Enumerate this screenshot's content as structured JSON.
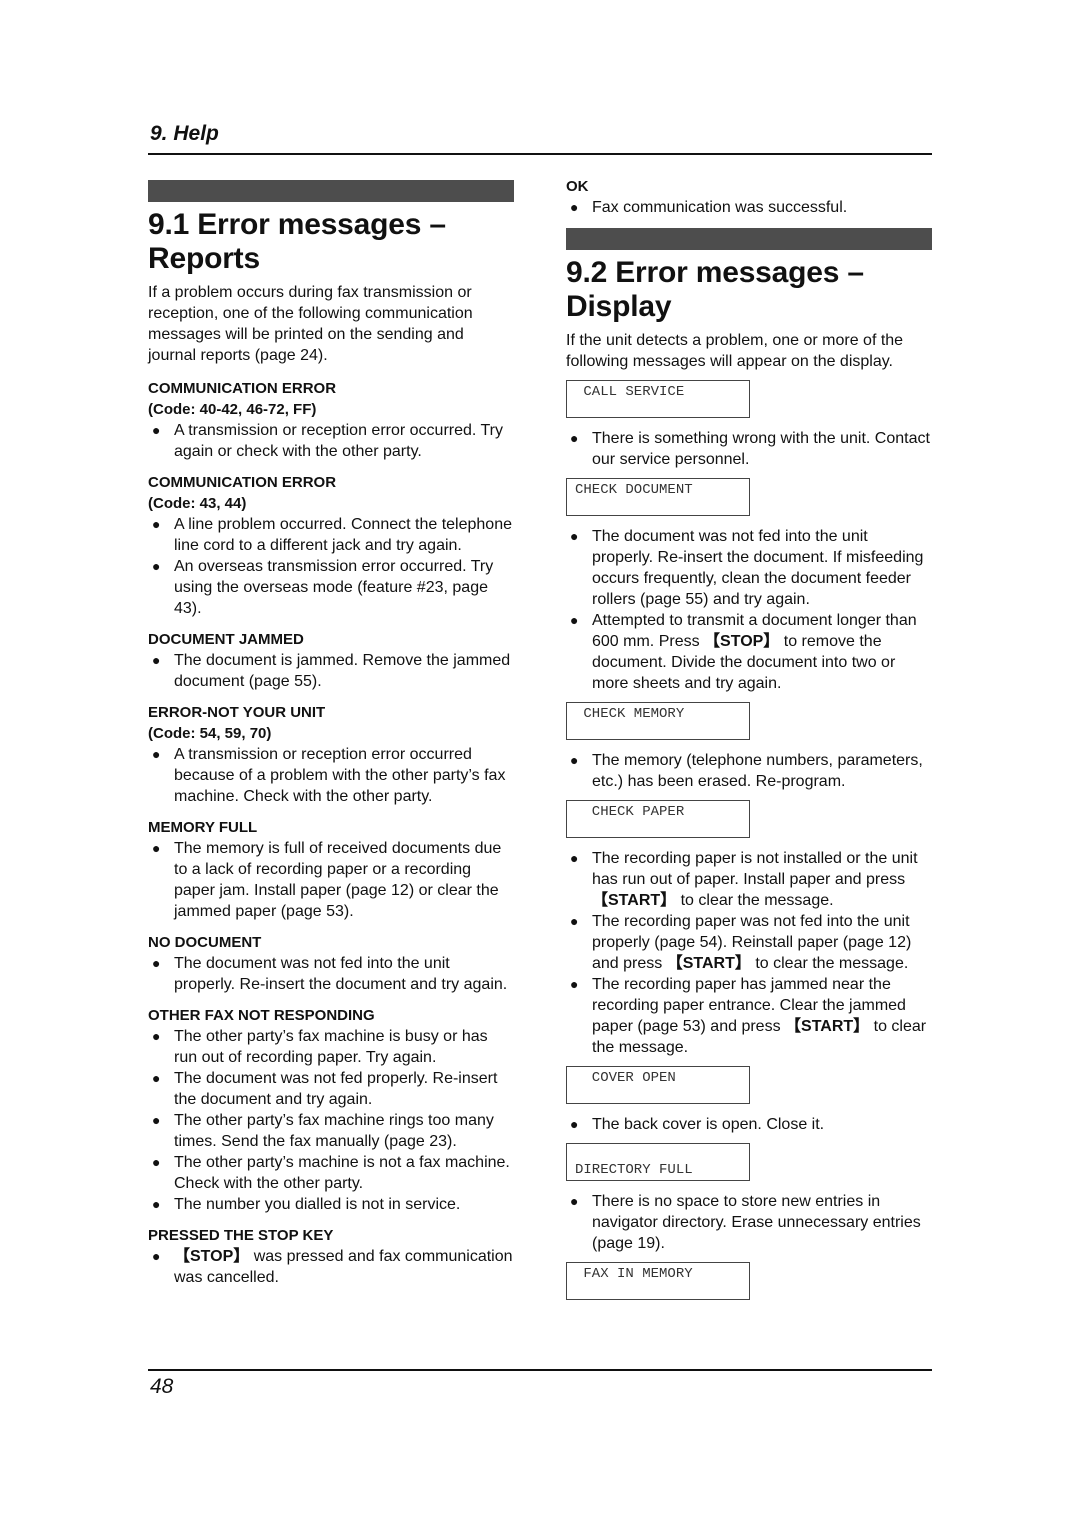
{
  "header": {
    "title": "9. Help"
  },
  "footer": {
    "page_number": "48"
  },
  "section1": {
    "title": "9.1 Error messages – Reports",
    "intro": "If a problem occurs during fax transmission or reception, one of the following communication messages will be printed on the sending and journal reports (page 24).",
    "entries": [
      {
        "title": "COMMUNICATION ERROR",
        "code": "(Code: 40-42, 46-72, FF)",
        "bullets": [
          "A transmission or reception error occurred. Try again or check with the other party."
        ]
      },
      {
        "title": "COMMUNICATION ERROR",
        "code": "(Code: 43, 44)",
        "bullets": [
          "A line problem occurred. Connect the telephone line cord to a different jack and try again.",
          "An overseas transmission error occurred. Try using the overseas mode (feature #23, page 43)."
        ]
      },
      {
        "title": "DOCUMENT JAMMED",
        "bullets": [
          "The document is jammed. Remove the jammed document (page 55)."
        ]
      },
      {
        "title": "ERROR-NOT YOUR UNIT",
        "code": "(Code: 54, 59, 70)",
        "bullets": [
          "A transmission or reception error occurred because of a problem with the other party’s fax machine. Check with the other party."
        ]
      },
      {
        "title": "MEMORY FULL",
        "bullets": [
          "The memory is full of received documents due to a lack of recording paper or a recording paper jam. Install paper (page 12) or clear the jammed paper (page 53)."
        ]
      },
      {
        "title": "NO DOCUMENT",
        "bullets": [
          "The document was not fed into the unit properly. Re-insert the document and try again."
        ]
      },
      {
        "title": "OTHER FAX NOT RESPONDING",
        "bullets": [
          "The other party’s fax machine is busy or has run out of recording paper. Try again.",
          "The document was not fed properly. Re-insert the document and try again.",
          "The other party’s fax machine rings too many times. Send the fax manually (page 23).",
          "The other party’s machine is not a fax machine. Check with the other party.",
          "The number you dialled is not in service."
        ]
      },
      {
        "title": "PRESSED THE STOP KEY",
        "bullets_rich": [
          {
            "key": "【STOP】",
            "text": " was pressed and fax communication was cancelled."
          }
        ]
      }
    ],
    "ok_entry": {
      "title": "OK",
      "bullets": [
        "Fax communication was successful."
      ]
    }
  },
  "section2": {
    "title": "9.2 Error messages – Display",
    "intro": "If the unit detects a problem, one or more of the following messages will appear on the display.",
    "messages": [
      {
        "display": " CALL SERVICE",
        "bullets": [
          "There is something wrong with the unit. Contact our service personnel."
        ]
      },
      {
        "display": "CHECK DOCUMENT",
        "bullets": [
          "The document was not fed into the unit properly. Re-insert the document. If misfeeding occurs frequently, clean the document feeder rollers (page 55) and try again."
        ],
        "bullet_rich": {
          "before": "Attempted to transmit a document longer than 600 mm. Press ",
          "key": "【STOP】",
          "after": " to remove the document. Divide the document into two or more sheets and try again."
        }
      },
      {
        "display": " CHECK MEMORY",
        "bullets": [
          "The memory (telephone numbers, parameters, etc.) has been erased. Re-program."
        ]
      },
      {
        "display": "  CHECK PAPER",
        "bullets_rich": [
          {
            "before": "The recording paper is not installed or the unit has run out of paper. Install paper and press ",
            "key": "【START】",
            "after": " to clear the message."
          },
          {
            "before": "The recording paper was not fed into the unit properly (page 54). Reinstall paper (page 12) and press ",
            "key": "【START】",
            "after": " to clear the message."
          },
          {
            "before": "The recording paper has jammed near the recording paper entrance. Clear the jammed paper (page 53) and press ",
            "key": "【START】",
            "after": " to clear the message."
          }
        ]
      },
      {
        "display": "  COVER OPEN",
        "bullets": [
          "The back cover is open. Close it."
        ]
      },
      {
        "display": "DIRECTORY FULL",
        "bullets": [
          "There is no space to store new entries in navigator directory. Erase unnecessary entries (page 19)."
        ]
      },
      {
        "display": " FAX IN MEMORY"
      }
    ]
  },
  "bullet_glyph": "●"
}
